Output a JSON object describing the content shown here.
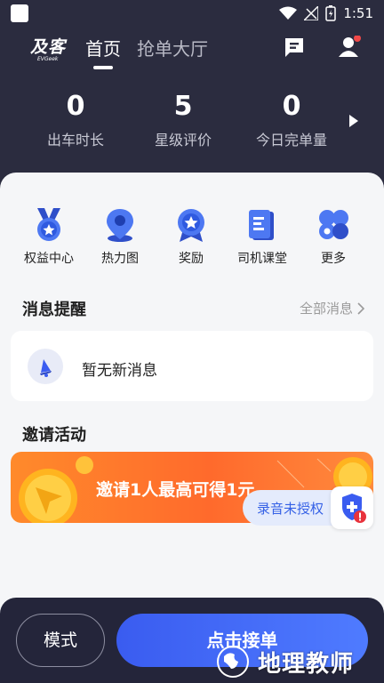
{
  "status_bar": {
    "time": "1:51"
  },
  "header": {
    "logo_cn": "及客",
    "logo_en": "EVGeek",
    "tabs": [
      {
        "label": "首页",
        "active": true
      },
      {
        "label": "抢单大厅",
        "active": false
      }
    ],
    "icons": [
      "message-icon",
      "user-icon"
    ],
    "notification_dot_color": "#f04848"
  },
  "stats": [
    {
      "value": "0",
      "label": "出车时长"
    },
    {
      "value": "5",
      "label": "星级评价"
    },
    {
      "value": "0",
      "label": "今日完单量"
    }
  ],
  "quick_actions": [
    {
      "label": "权益中心",
      "icon": "medal-icon"
    },
    {
      "label": "热力图",
      "icon": "location-pin-icon"
    },
    {
      "label": "奖励",
      "icon": "award-icon"
    },
    {
      "label": "司机课堂",
      "icon": "classroom-icon"
    },
    {
      "label": "更多",
      "icon": "more-icon"
    }
  ],
  "messages": {
    "title": "消息提醒",
    "more_link": "全部消息",
    "empty_text": "暂无新消息"
  },
  "invite": {
    "title": "邀请活动",
    "banner_text": "邀请1人最高可得1元"
  },
  "recording": {
    "label": "录音未授权"
  },
  "bottom": {
    "mode_label": "模式",
    "accept_label": "点击接单"
  },
  "watermark": {
    "text": "地理教师"
  },
  "colors": {
    "accent": "#3a5cf0",
    "header_bg": "#2b2c3f",
    "banner_orange": "#ff7a2c"
  }
}
